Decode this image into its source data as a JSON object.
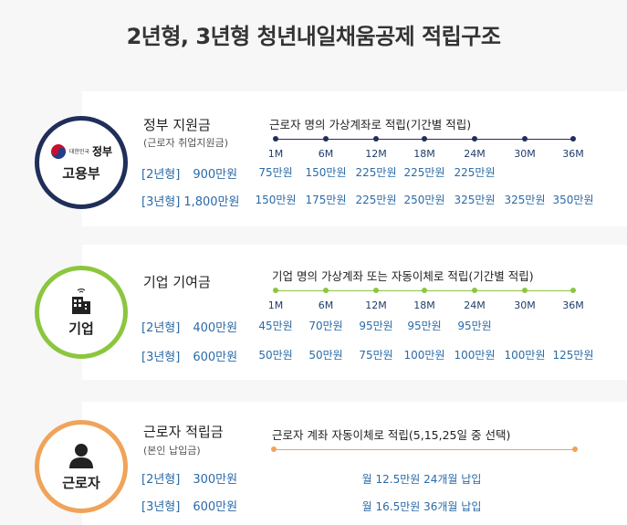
{
  "title": "2년형, 3년형 청년내일채움공제 적립구조",
  "months": [
    "1M",
    "6M",
    "12M",
    "18M",
    "24M",
    "30M",
    "36M"
  ],
  "sections": {
    "gov": {
      "badge_small": "대한민국",
      "badge_big": "정부",
      "circle_label": "고용부",
      "title": "정부 지원금",
      "subtitle": "(근로자 취업지원금)",
      "caption": "근로자 명의 가상계좌로 적립(기간별 적립)",
      "row2_label": "[2년형]",
      "row2_amount": "900만원",
      "row3_label": "[3년형]",
      "row3_amount": "1,800만원",
      "row2_values": [
        "75만원",
        "150만원",
        "225만원",
        "225만원",
        "225만원"
      ],
      "row3_values": [
        "150만원",
        "175만원",
        "225만원",
        "250만원",
        "325만원",
        "325만원",
        "350만원"
      ]
    },
    "company": {
      "circle_label": "기업",
      "title": "기업 기여금",
      "caption": "기업 명의 가상계좌 또는 자동이체로 적립(기간별 적립)",
      "row2_label": "[2년형]",
      "row2_amount": "400만원",
      "row3_label": "[3년형]",
      "row3_amount": "600만원",
      "row2_values": [
        "45만원",
        "70만원",
        "95만원",
        "95만원",
        "95만원"
      ],
      "row3_values": [
        "50만원",
        "50만원",
        "75만원",
        "100만원",
        "100만원",
        "100만원",
        "125만원"
      ]
    },
    "worker": {
      "circle_label": "근로자",
      "title": "근로자 적립금",
      "subtitle": "(본인 납입금)",
      "caption": "근로자 계좌 자동이체로 적립(5,15,25일 중 선택)",
      "row2_label": "[2년형]",
      "row2_amount": "300만원",
      "row3_label": "[3년형]",
      "row3_amount": "600만원",
      "row2_note": "월 12.5만원 24개월 납입",
      "row3_note": "월 16.5만원 36개월 납입"
    }
  },
  "colors": {
    "gov": "#1f2f5a",
    "company": "#8cc63f",
    "worker": "#f0a35a",
    "value_text": "#2a6aa8"
  }
}
